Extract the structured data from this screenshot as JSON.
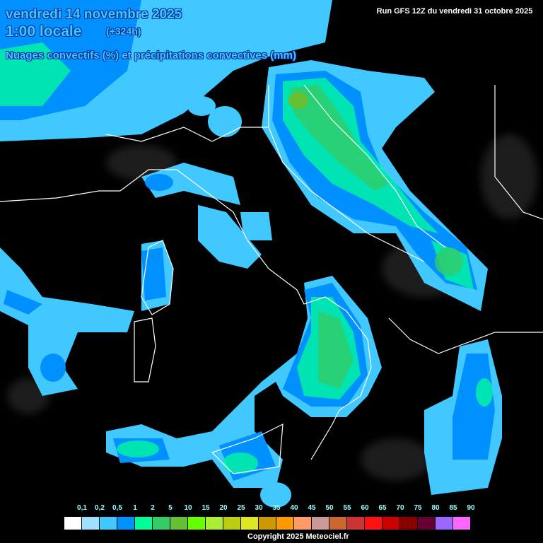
{
  "header": {
    "date": "vendredi 14 novembre 2025",
    "time": "1:00 locale",
    "lead": "(+324h)",
    "title": "Nuages convectifs (%) et précipitations convectives (mm)",
    "run": "Run GFS 12Z du vendredi 31 octobre 2025"
  },
  "legend": {
    "labels": [
      "0,1",
      "0,2",
      "0,5",
      "1",
      "2",
      "5",
      "10",
      "15",
      "20",
      "25",
      "30",
      "35",
      "40",
      "45",
      "50",
      "55",
      "60",
      "65",
      "70",
      "75",
      "80",
      "85",
      "90"
    ],
    "colors": [
      "#ffffff",
      "#a0e0ff",
      "#40c8ff",
      "#0090ff",
      "#00ff99",
      "#33cc66",
      "#66c033",
      "#66ff00",
      "#aaee33",
      "#bbcc11",
      "#dde822",
      "#cc9900",
      "#ff9900",
      "#ff9966",
      "#cc9999",
      "#cc6633",
      "#cc3333",
      "#ff1111",
      "#cc0000",
      "#880000",
      "#660033",
      "#9966ff",
      "#ff66ff"
    ]
  },
  "footer": {
    "copyright": "Copyright 2025 Meteociel.fr"
  }
}
